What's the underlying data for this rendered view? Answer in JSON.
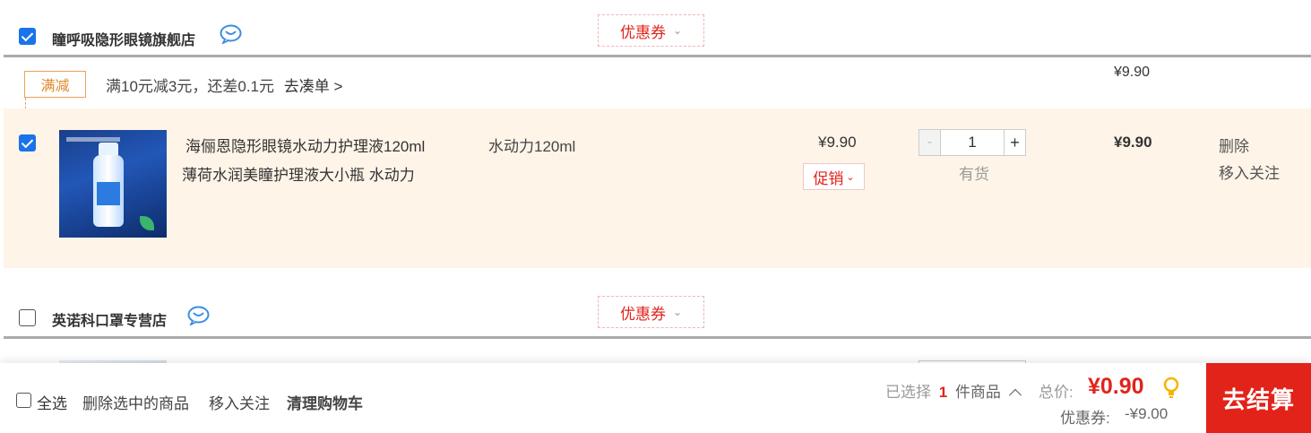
{
  "shops": [
    {
      "name": "瞳呼吸隐形眼镜旗舰店",
      "coupon_label": "优惠券",
      "checked": true,
      "promotion": {
        "tag": "满减",
        "text": "满10元减3元，还差0.1元",
        "link": "去凑单 >",
        "subtotal": "¥9.90"
      },
      "item": {
        "title_line1": "海俪恩隐形眼镜水动力护理液120ml",
        "title_line2": "薄荷水润美瞳护理液大小瓶 水动力",
        "spec": "水动力120ml",
        "unit_price": "¥9.90",
        "promo_label": "促销",
        "quantity": "1",
        "minus": "-",
        "plus": "+",
        "stock": "有货",
        "line_total": "¥9.90",
        "delete_label": "删除",
        "follow_label": "移入关注"
      }
    },
    {
      "name": "英诺科口罩专营店",
      "coupon_label": "优惠券",
      "checked": false
    }
  ],
  "footer": {
    "select_all": "全选",
    "delete_selected": "删除选中的商品",
    "move_to_follow": "移入关注",
    "clear_cart": "清理购物车",
    "selected_prefix": "已选择",
    "selected_count": "1",
    "selected_suffix": "件商品",
    "total_label": "总价:",
    "total_value": "¥0.90",
    "coupon_label": "优惠券:",
    "coupon_value": "-¥9.00",
    "checkout_label": "去结算"
  },
  "colors": {
    "accent": "#e2231a",
    "checkbox": "#1a73e8",
    "promo_band": "#fff4e8",
    "manjian": "#e08a2c"
  },
  "icons": [
    "chat-icon",
    "chevron-down-icon",
    "lightbulb-icon",
    "chevron-up-icon"
  ]
}
